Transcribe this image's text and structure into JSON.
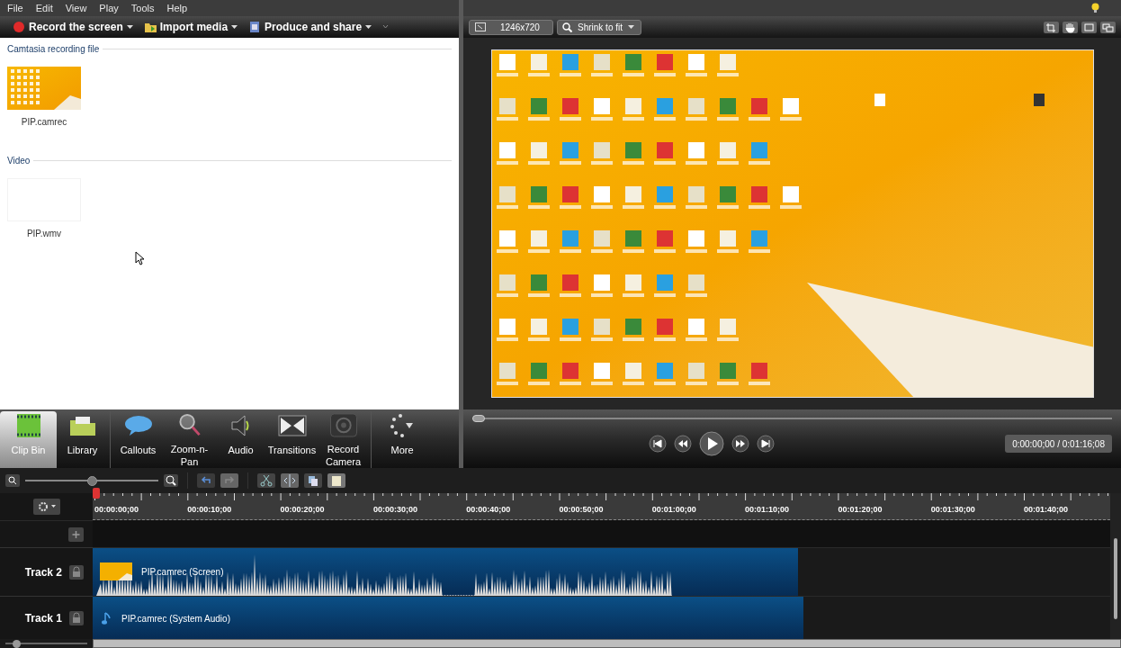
{
  "menu": [
    "File",
    "Edit",
    "View",
    "Play",
    "Tools",
    "Help"
  ],
  "toolbar": [
    {
      "label": "Record the screen",
      "kind": "record"
    },
    {
      "label": "Import media",
      "kind": "import"
    },
    {
      "label": "Produce and share",
      "kind": "produce"
    }
  ],
  "clip_bin": {
    "sections": [
      {
        "title": "Camtasia recording file",
        "clips": [
          {
            "name": "PIP.camrec",
            "kind": "screen"
          }
        ]
      },
      {
        "title": "Video",
        "clips": [
          {
            "name": "PIP.wmv",
            "kind": "blank"
          }
        ]
      }
    ]
  },
  "preview_toolbar": {
    "size": "1246x720",
    "zoom": "Shrink to fit"
  },
  "tasks": [
    {
      "label": "Clip Bin",
      "kind": "clipbin",
      "selected": true
    },
    {
      "label": "Library",
      "kind": "library",
      "selected": false
    },
    {
      "label": "Callouts",
      "kind": "callouts",
      "selected": false
    },
    {
      "label": "Zoom-n-Pan",
      "kind": "zoom",
      "selected": false
    },
    {
      "label": "Audio",
      "kind": "audio",
      "selected": false
    },
    {
      "label": "Transitions",
      "kind": "transitions",
      "selected": false
    },
    {
      "label": "Record Camera",
      "kind": "camera",
      "selected": false
    },
    {
      "label": "More",
      "kind": "more",
      "selected": false
    }
  ],
  "player": {
    "time": "0:00:00;00 / 0:01:16;08",
    "level": 0.0
  },
  "timeline": {
    "zoom_slider": {
      "level": 0.5
    },
    "track_height_slider": {
      "level": 0.1
    },
    "ruler": [
      "00:00:00;00",
      "00:00:10;00",
      "00:00:20;00",
      "00:00:30;00",
      "00:00:40;00",
      "00:00:50;00",
      "00:01:00;00",
      "00:01:10;00",
      "00:01:20;00",
      "00:01:30;00",
      "00:01:40;00"
    ],
    "tracks": [
      {
        "name": "Track 2",
        "clip": "PIP.camrec (Screen)",
        "kind": "video"
      },
      {
        "name": "Track 1",
        "clip": "PIP.camrec (System Audio)",
        "kind": "audio"
      }
    ]
  }
}
